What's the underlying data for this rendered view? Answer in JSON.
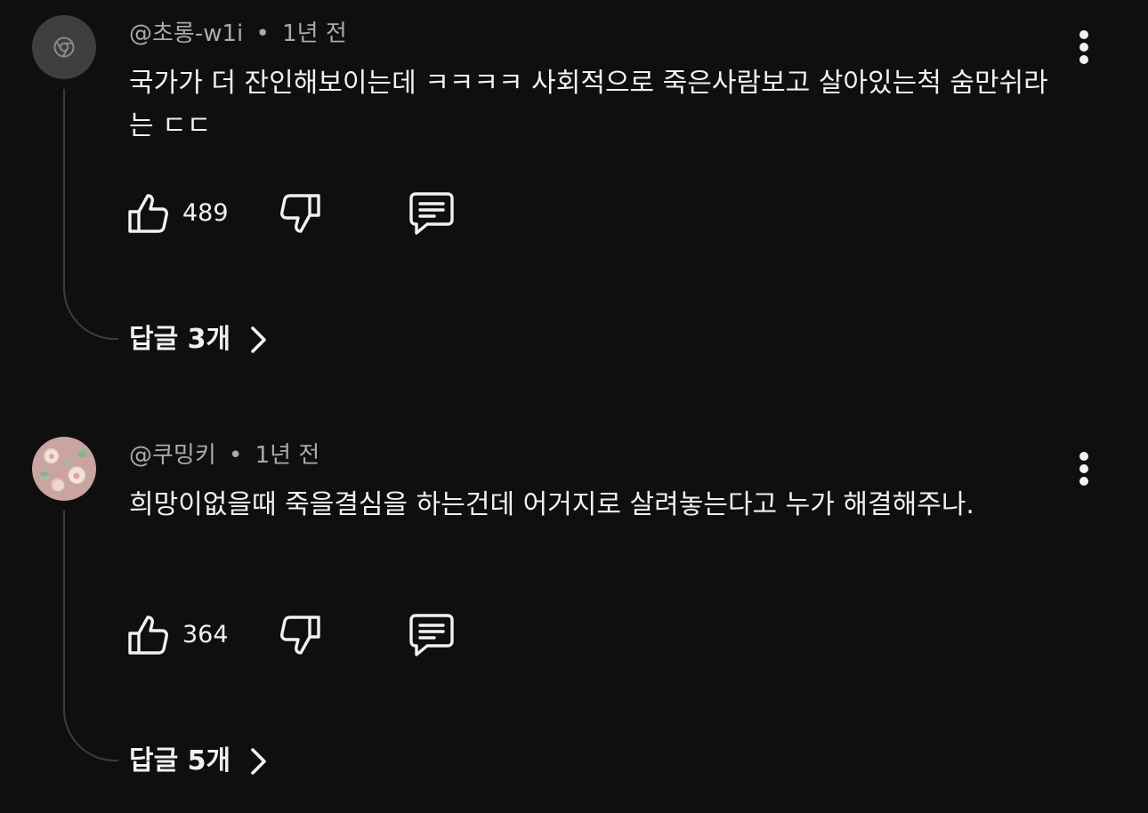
{
  "comments": [
    {
      "author": "@초롱-w1i",
      "separator": "•",
      "time": "1년 전",
      "text": "국가가 더 잔인해보이는데 ㅋㅋㅋㅋ 사회적으로 죽은사람보고 살아있는척 숨만쉬라는 ㄷㄷ",
      "likes": "489",
      "replies_label": "답글 3개",
      "avatar_icon": "chrome-logo-icon"
    },
    {
      "author": "@쿠밍키",
      "separator": "•",
      "time": "1년 전",
      "text": "희망이없을때 죽을결심을 하는건데 어거지로 살려놓는다고 누가 해결해주나.",
      "likes": "364",
      "replies_label": "답글 5개",
      "avatar_icon": "floral-avatar"
    }
  ],
  "colors": {
    "background": "#0f0f0f",
    "primary_text": "#f1f1f1",
    "secondary_text": "#aaaaaa",
    "thread_line": "#3d3d3d"
  }
}
